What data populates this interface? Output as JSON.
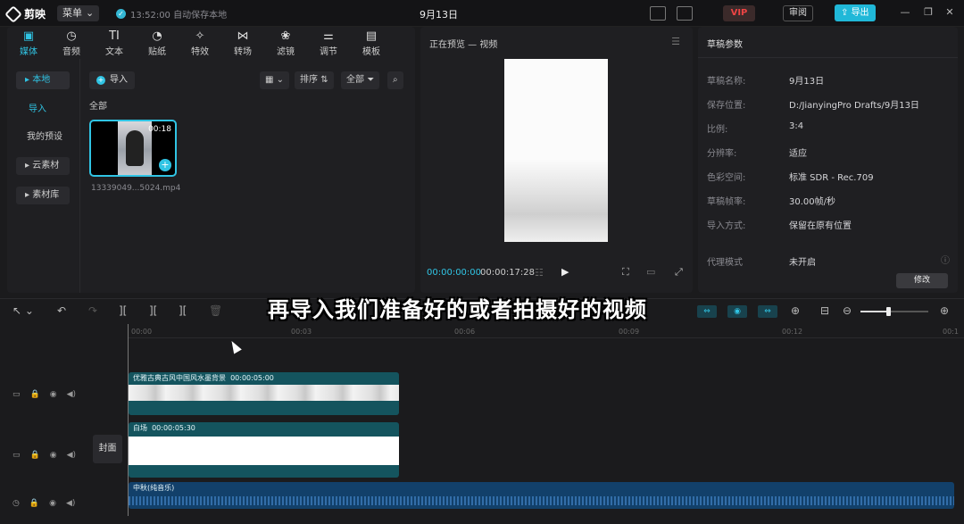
{
  "titlebar": {
    "app_name": "剪映",
    "menu_label": "菜单",
    "save_status": "13:52:00 自动保存本地",
    "project_title": "9月13日",
    "vip_label": "VIP",
    "review_label": "审阅",
    "export_label": "导出"
  },
  "media_tabs": [
    {
      "label": "媒体",
      "icon": "media-icon",
      "glyph": "▣"
    },
    {
      "label": "音频",
      "icon": "audio-icon",
      "glyph": "◷"
    },
    {
      "label": "文本",
      "icon": "text-icon",
      "glyph": "TI"
    },
    {
      "label": "贴纸",
      "icon": "sticker-icon",
      "glyph": "◔"
    },
    {
      "label": "特效",
      "icon": "effects-icon",
      "glyph": "✧"
    },
    {
      "label": "转场",
      "icon": "transition-icon",
      "glyph": "⋈"
    },
    {
      "label": "滤镜",
      "icon": "filter-icon",
      "glyph": "❀"
    },
    {
      "label": "调节",
      "icon": "adjust-icon",
      "glyph": "⚌"
    },
    {
      "label": "模板",
      "icon": "template-icon",
      "glyph": "▤"
    }
  ],
  "sidebar": {
    "local": "本地",
    "import": "导入",
    "my_presets": "我的预设",
    "cloud": "云素材",
    "library": "素材库"
  },
  "media": {
    "import_button": "导入",
    "sort_label": "排序",
    "filter_label": "全部",
    "section_label": "全部",
    "clip": {
      "duration": "00:18",
      "filename": "13339049...5024.mp4"
    }
  },
  "preview": {
    "title": "正在预览 — 视频",
    "current_time": "00:00:00:00",
    "total_time": "00:00:17:28"
  },
  "properties": {
    "title": "草稿参数",
    "rows": [
      {
        "key": "草稿名称:",
        "value": "9月13日"
      },
      {
        "key": "保存位置:",
        "value": "D:/JianyingPro Drafts/9月13日"
      },
      {
        "key": "比例:",
        "value": "3:4"
      },
      {
        "key": "分辨率:",
        "value": "适应"
      },
      {
        "key": "色彩空间:",
        "value": "标准 SDR - Rec.709"
      },
      {
        "key": "草稿帧率:",
        "value": "30.00帧/秒"
      },
      {
        "key": "导入方式:",
        "value": "保留在原有位置"
      },
      {
        "key": "代理模式",
        "value": "未开启"
      }
    ],
    "edit_button": "修改"
  },
  "timeline": {
    "ticks": [
      "00:00",
      "00:03",
      "00:06",
      "00:09",
      "00:12",
      "00:1"
    ],
    "cover_label": "封面",
    "clips": {
      "video1": {
        "title": "优雅古典古风中国风水墨背景",
        "duration": "00:00:05:00"
      },
      "video2": {
        "title": "白场",
        "duration": "00:00:05:30"
      },
      "audio": {
        "title": "中秋(纯音乐)"
      }
    }
  },
  "subtitle_overlay": "再导入我们准备好的或者拍摄好的视频"
}
